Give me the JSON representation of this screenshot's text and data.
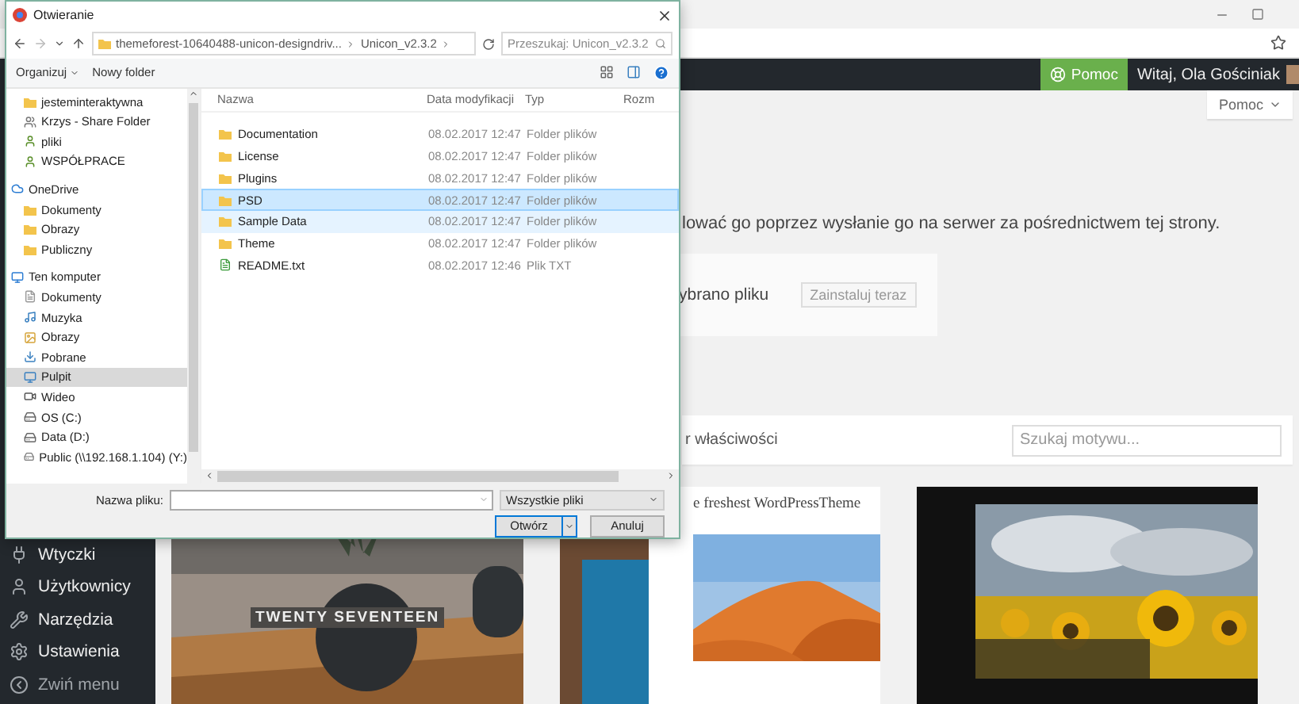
{
  "browser": {
    "bookmarked": false
  },
  "admin_bar": {
    "help_button": "Pomoc",
    "greeting": "Witaj, Ola Gościniak"
  },
  "sidebar": {
    "items": [
      {
        "label": "Wtyczki",
        "kind": "plugins"
      },
      {
        "label": "Użytkownicy",
        "kind": "users"
      },
      {
        "label": "Narzędzia",
        "kind": "tools"
      },
      {
        "label": "Ustawienia",
        "kind": "settings"
      },
      {
        "label": "Zwiń menu",
        "kind": "collapse"
      }
    ]
  },
  "content": {
    "help_tab": "Pomoc",
    "intro": "lować go poprzez wysłanie go na serwer za pośrednictwem tej strony.",
    "upload": {
      "file_status": "ybrano pliku",
      "install_button": "Zainstaluj teraz"
    },
    "filter": {
      "label": "r właściwości",
      "search_placeholder": "Szukaj motywu..."
    },
    "themes": [
      {
        "kind": "plant",
        "title": "TWENTY SEVENTEEN"
      },
      {
        "kind": "desert",
        "title": "e freshest WordPressTheme"
      },
      {
        "kind": "sunflower"
      }
    ]
  },
  "dialog": {
    "title": "Otwieranie",
    "path": [
      "themeforest-10640488-unicon-designdriv...",
      "Unicon_v2.3.2"
    ],
    "search_placeholder": "Przeszukaj: Unicon_v2.3.2",
    "toolbar": [
      "Organizuj",
      "Nowy folder"
    ],
    "nav_pane": {
      "scrolled_items": [
        {
          "label": "jesteminteraktywna",
          "kind": "folder",
          "selected": false
        },
        {
          "label": "Krzys - Share Folder",
          "kind": "share",
          "selected": false
        },
        {
          "label": "pliki",
          "kind": "user",
          "selected": false
        },
        {
          "label": "WSPÓŁPRACE",
          "kind": "user",
          "selected": false
        }
      ],
      "items": [
        {
          "label": "OneDrive",
          "kind": "cloud",
          "selected": false,
          "children": [
            {
              "label": "Dokumenty",
              "kind": "folder",
              "selected": false
            },
            {
              "label": "Obrazy",
              "kind": "folder",
              "selected": false
            },
            {
              "label": "Publiczny",
              "kind": "folder",
              "selected": false
            }
          ]
        },
        {
          "label": "Ten komputer",
          "kind": "computer",
          "selected": false,
          "children": [
            {
              "label": "Dokumenty",
              "kind": "documents",
              "selected": false
            },
            {
              "label": "Muzyka",
              "kind": "music",
              "selected": false
            },
            {
              "label": "Obrazy",
              "kind": "pictures",
              "selected": false
            },
            {
              "label": "Pobrane",
              "kind": "downloads",
              "selected": false
            },
            {
              "label": "Pulpit",
              "kind": "desktop",
              "selected": true
            },
            {
              "label": "Wideo",
              "kind": "video",
              "selected": false
            },
            {
              "label": "OS (C:)",
              "kind": "drive",
              "selected": false
            },
            {
              "label": "Data (D:)",
              "kind": "drive",
              "selected": false
            },
            {
              "label": "Public (\\\\192.168.1.104) (Y:)",
              "kind": "netdrive",
              "selected": false
            }
          ]
        }
      ]
    },
    "columns": [
      "Nazwa",
      "Data modyfikacji",
      "Typ",
      "Rozm"
    ],
    "files": [
      {
        "name": "Documentation",
        "date": "08.02.2017 12:47",
        "type": "Folder plików",
        "kind": "folder",
        "selected": false,
        "hovered": false
      },
      {
        "name": "License",
        "date": "08.02.2017 12:47",
        "type": "Folder plików",
        "kind": "folder",
        "selected": false,
        "hovered": false
      },
      {
        "name": "Plugins",
        "date": "08.02.2017 12:47",
        "type": "Folder plików",
        "kind": "folder",
        "selected": false,
        "hovered": false
      },
      {
        "name": "PSD",
        "date": "08.02.2017 12:47",
        "type": "Folder plików",
        "kind": "folder",
        "selected": true,
        "hovered": false
      },
      {
        "name": "Sample Data",
        "date": "08.02.2017 12:47",
        "type": "Folder plików",
        "kind": "folder",
        "selected": false,
        "hovered": true
      },
      {
        "name": "Theme",
        "date": "08.02.2017 12:47",
        "type": "Folder plików",
        "kind": "folder",
        "selected": false,
        "hovered": false
      },
      {
        "name": "README.txt",
        "date": "08.02.2017 12:46",
        "type": "Plik TXT",
        "kind": "text",
        "selected": false,
        "hovered": false
      }
    ],
    "filename_label": "Nazwa pliku:",
    "file_filter": "Wszystkie pliki",
    "buttons": [
      {
        "label": "Otwórz",
        "kind": "split"
      },
      {
        "label": "Anuluj",
        "kind": "plain"
      }
    ]
  }
}
